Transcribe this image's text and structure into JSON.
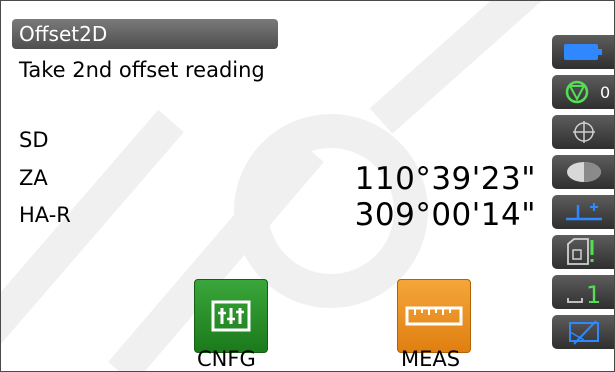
{
  "screen": {
    "title": "Offset2D",
    "message": "Take 2nd offset reading"
  },
  "measurements": [
    {
      "label": "SD",
      "value": ""
    },
    {
      "label": "ZA",
      "value": "110°39'23\""
    },
    {
      "label": "HA-R",
      "value": "309°00'14\""
    }
  ],
  "side_panel": {
    "battery": {
      "icon": "battery-icon"
    },
    "target": {
      "icon": "prism-target-icon",
      "value": "0"
    },
    "tilt": {
      "icon": "crosshair-icon"
    },
    "laser": {
      "icon": "half-circle-icon"
    },
    "face": {
      "icon": "face-level-icon"
    },
    "sd_card": {
      "icon": "sd-card-icon"
    },
    "page": {
      "icon": "page-number-icon",
      "value": "1"
    },
    "input_mode": {
      "icon": "input-mode-icon"
    }
  },
  "softkeys": [
    {
      "label": "CNFG",
      "icon": "config-icon",
      "color": "#2e9a2e"
    },
    {
      "label": "MEAS",
      "icon": "ruler-icon",
      "color": "#f09a30"
    }
  ]
}
